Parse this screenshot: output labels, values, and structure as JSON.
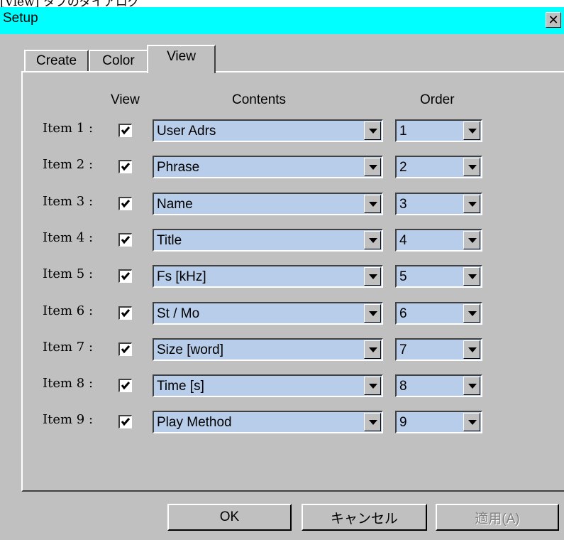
{
  "page_caption_fragment": "[View] タブのダイアログ",
  "window": {
    "title": "Setup",
    "close_glyph": "✕"
  },
  "tabs": [
    {
      "label": "Create",
      "active": false
    },
    {
      "label": "Color",
      "active": false
    },
    {
      "label": "View",
      "active": true
    }
  ],
  "headers": {
    "view": "View",
    "contents": "Contents",
    "order": "Order"
  },
  "items": [
    {
      "label": "Item 1 :",
      "checked": true,
      "content": "User Adrs",
      "order": "1"
    },
    {
      "label": "Item 2 :",
      "checked": true,
      "content": "Phrase",
      "order": "2"
    },
    {
      "label": "Item 3 :",
      "checked": true,
      "content": "Name",
      "order": "3"
    },
    {
      "label": "Item 4 :",
      "checked": true,
      "content": "Title",
      "order": "4"
    },
    {
      "label": "Item 5 :",
      "checked": true,
      "content": "Fs [kHz]",
      "order": "5"
    },
    {
      "label": "Item 6 :",
      "checked": true,
      "content": "St / Mo",
      "order": "6"
    },
    {
      "label": "Item 7 :",
      "checked": true,
      "content": "Size [word]",
      "order": "7"
    },
    {
      "label": "Item 8 :",
      "checked": true,
      "content": "Time [s]",
      "order": "8"
    },
    {
      "label": "Item 9 :",
      "checked": true,
      "content": "Play Method",
      "order": "9"
    }
  ],
  "buttons": {
    "ok": "OK",
    "cancel": "キャンセル",
    "apply": "適用(A)"
  },
  "colors": {
    "titlebar": "#00ffff",
    "face": "#c0c0c0",
    "combo_fill": "#b7cde9"
  },
  "icons": {
    "close": "close-icon",
    "dropdown": "chevron-down-icon",
    "check": "checkmark-icon"
  }
}
